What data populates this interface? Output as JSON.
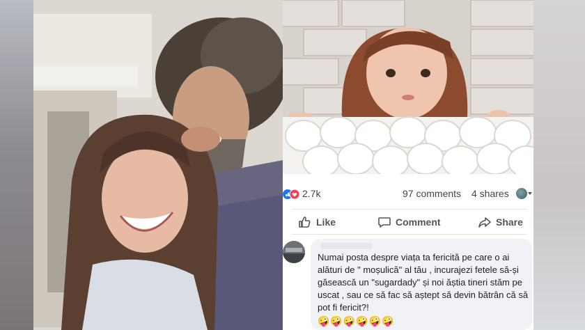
{
  "post": {
    "reactions_count": "2.7k",
    "comments_count": "97 comments",
    "shares_count": "4 shares",
    "reaction_icons": [
      "like-icon",
      "love-icon"
    ]
  },
  "actions": {
    "like_label": "Like",
    "comment_label": "Comment",
    "share_label": "Share"
  },
  "comment": {
    "text": "Numai posta despre viața ta fericită pe care o ai alături de \" moșulică\" al tău , incurajezi fetele să-și găsească un \"sugardady\" și noi ăștia tineri stăm pe uscat , sau ce să fac să aștept să devin bătrân că să pot fi fericit?!",
    "emoji": "🤪🤪🤪🤪🤪🤪"
  },
  "colors": {
    "like_blue": "#1877f2",
    "love_red": "#f33e58",
    "bubble_bg": "#f0f2f5",
    "text_gray": "#444444"
  }
}
